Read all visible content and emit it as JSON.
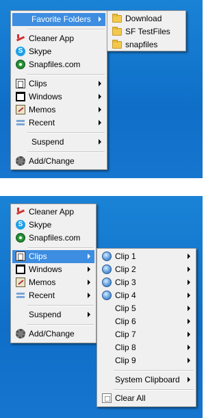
{
  "screenshot_top": {
    "main_menu": {
      "favorite_folders": "Favorite Folders",
      "cleaner_app": "Cleaner App",
      "skype": "Skype",
      "snapfiles": "Snapfiles.com",
      "clips": "Clips",
      "windows": "Windows",
      "memos": "Memos",
      "recent": "Recent",
      "suspend": "Suspend",
      "add_change": "Add/Change"
    },
    "favorites_submenu": {
      "items": [
        "Download",
        "SF TestFiles",
        "snapfiles"
      ]
    }
  },
  "screenshot_bottom": {
    "main_menu": {
      "cleaner_app": "Cleaner App",
      "skype": "Skype",
      "snapfiles": "Snapfiles.com",
      "clips": "Clips",
      "windows": "Windows",
      "memos": "Memos",
      "recent": "Recent",
      "suspend": "Suspend",
      "add_change": "Add/Change"
    },
    "clips_submenu": {
      "clips": [
        "Clip 1",
        "Clip 2",
        "Clip 3",
        "Clip 4",
        "Clip 5",
        "Clip 6",
        "Clip 7",
        "Clip 8",
        "Clip 9"
      ],
      "system_clipboard": "System Clipboard",
      "clear_all": "Clear All"
    }
  },
  "colors": {
    "desktop": "#0f6fc8",
    "menu_bg": "#f0f0f0",
    "highlight": "#3d8de0"
  }
}
